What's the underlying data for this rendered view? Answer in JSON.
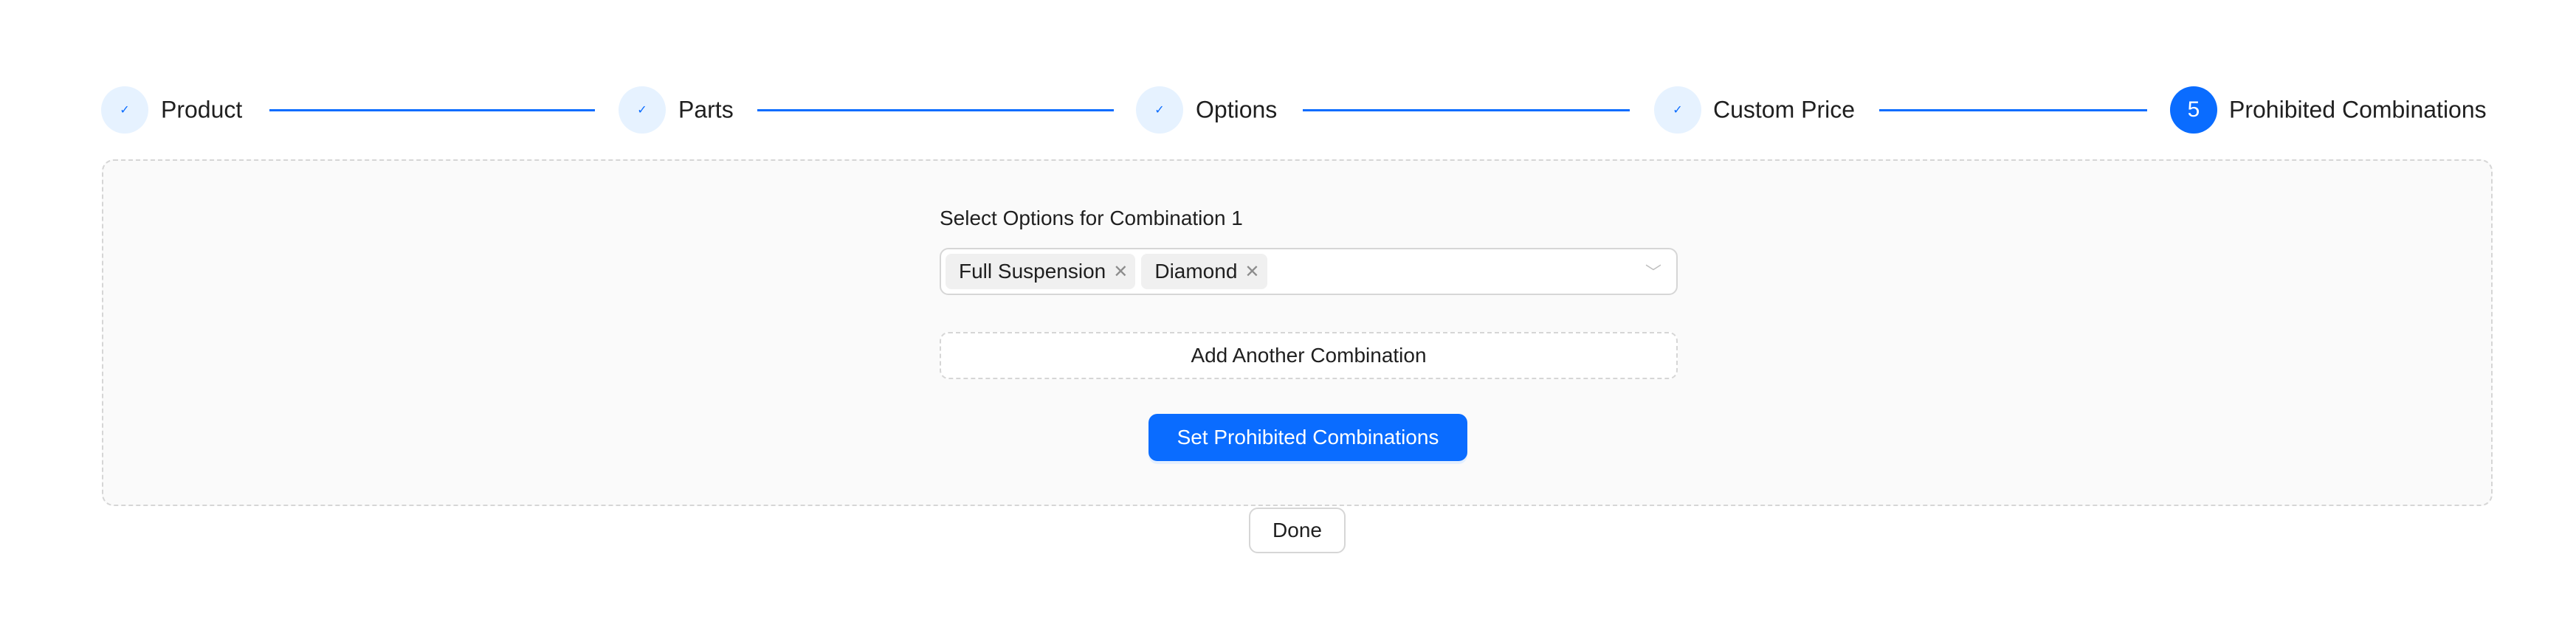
{
  "steps": [
    {
      "label": "Product",
      "status": "finished",
      "icon": "check-icon"
    },
    {
      "label": "Parts",
      "status": "finished",
      "icon": "check-icon"
    },
    {
      "label": "Options",
      "status": "finished",
      "icon": "check-icon"
    },
    {
      "label": "Custom Price",
      "status": "finished",
      "icon": "check-icon"
    },
    {
      "label": "Prohibited Combinations",
      "status": "active",
      "number": "5"
    }
  ],
  "form": {
    "combination_label": "Select Options for Combination 1",
    "selected_tags": [
      "Full Suspension",
      "Diamond"
    ],
    "add_combination_label": "Add Another Combination",
    "submit_label": "Set Prohibited Combinations"
  },
  "done_label": "Done",
  "colors": {
    "primary": "#0a6cff",
    "panel_bg": "#fafafa",
    "border": "#d6d6d6"
  }
}
